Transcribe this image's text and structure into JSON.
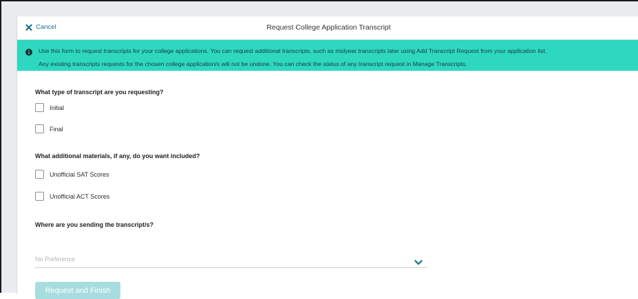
{
  "header": {
    "cancel_label": "Cancel",
    "title": "Request College Application Transcript"
  },
  "info": {
    "line1": "Use this form to request transcripts for your college applications. You can request additional transcripts, such as midyear transcripts later using Add Transcript Request from your application list.",
    "line2": "Any existing transcripts requests for the chosen college application/s will not be undone. You can check the status of any transcript request in Manage Transcripts.",
    "icon": "info-circle-icon",
    "background_color": "#2ed8bf"
  },
  "form": {
    "transcript_type": {
      "question": "What type of transcript are you requesting?",
      "options": [
        {
          "label": "Initial",
          "checked": false
        },
        {
          "label": "Final",
          "checked": false
        }
      ]
    },
    "materials": {
      "question": "What additional materials, if any, do you want included?",
      "options": [
        {
          "label": "Unofficial SAT Scores",
          "checked": false
        },
        {
          "label": "Unofficial ACT Scores",
          "checked": false
        }
      ]
    },
    "destination": {
      "question": "Where are you sending the transcript/s?",
      "selected": "No Preference",
      "icon": "chevron-down-icon"
    },
    "submit_label": "Request and Finish"
  },
  "colors": {
    "accent": "#1f7f8b",
    "submit_disabled": "#a8dde0"
  }
}
